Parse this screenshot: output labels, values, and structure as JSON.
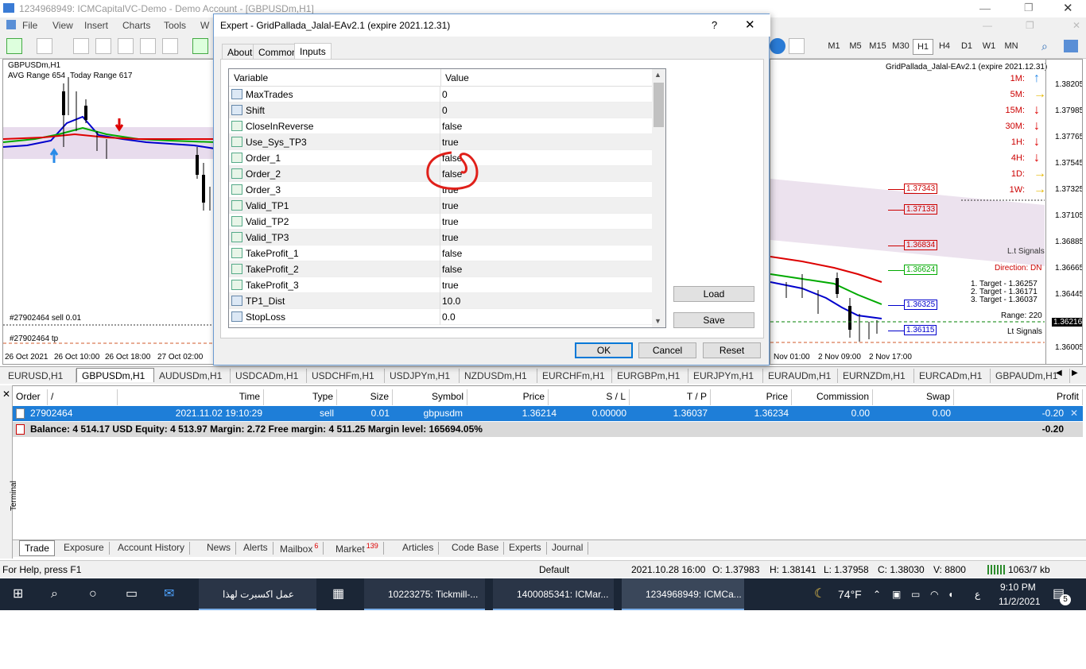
{
  "window": {
    "title": "1234968949: ICMCapitalVC-Demo - Demo Account - [GBPUSDm,H1]"
  },
  "menu": [
    "File",
    "View",
    "Insert",
    "Charts",
    "Tools",
    "W"
  ],
  "timeframes": [
    "M1",
    "M5",
    "M15",
    "M30",
    "H1",
    "H4",
    "D1",
    "W1",
    "MN"
  ],
  "active_timeframe": "H1",
  "chart_left": {
    "symbol": "GBPUSDm,H1",
    "avg_range": "AVG Range 654",
    "today_range": "Today Range 617",
    "order_label": "#27902464 sell 0.01",
    "tp_label": "#27902464 tp",
    "time_labels": [
      "26 Oct 2021",
      "26 Oct 10:00",
      "26 Oct 18:00",
      "27 Oct 02:00"
    ]
  },
  "chart_right": {
    "ea_label": "GridPallada_Jalal-EAv2.1 (expire 2021.12.31)",
    "tf_signals": [
      {
        "tf": "1M:",
        "dir": "up"
      },
      {
        "tf": "5M:",
        "dir": "right"
      },
      {
        "tf": "15M:",
        "dir": "down"
      },
      {
        "tf": "30M:",
        "dir": "down"
      },
      {
        "tf": "1H:",
        "dir": "down"
      },
      {
        "tf": "4H:",
        "dir": "down"
      },
      {
        "tf": "1D:",
        "dir": "right"
      },
      {
        "tf": "1W:",
        "dir": "right"
      }
    ],
    "price_axis": [
      "1.38205",
      "1.37985",
      "1.37765",
      "1.37545",
      "1.37325",
      "1.37105",
      "1.36885",
      "1.36665",
      "1.36445",
      "1.36216",
      "1.36005"
    ],
    "current_price": "1.36216",
    "levels": [
      {
        "value": "1.37343",
        "color": "#cc0000"
      },
      {
        "value": "1.37133",
        "color": "#cc0000"
      },
      {
        "value": "1.36834",
        "color": "#cc0000"
      },
      {
        "value": "1.36624",
        "color": "#00aa00"
      },
      {
        "value": "1.36325",
        "color": "#0000cc"
      },
      {
        "value": "1.36115",
        "color": "#0000cc"
      }
    ],
    "lt_signals": "L.t Signals",
    "direction": "Direction: DN",
    "targets": [
      "1. Target - 1.36257",
      "2. Target - 1.36171",
      "3. Target - 1.36037"
    ],
    "range": "Range: 220",
    "lt_signals2": "Lt Signals",
    "time_labels": [
      "Nov 01:00",
      "2 Nov 09:00",
      "2 Nov 17:00"
    ]
  },
  "dialog": {
    "title": "Expert - GridPallada_Jalal-EAv2.1 (expire 2021.12.31)",
    "help": "?",
    "close": "✕",
    "tabs": [
      "About",
      "Common",
      "Inputs"
    ],
    "active_tab": "Inputs",
    "col_variable": "Variable",
    "col_value": "Value",
    "params": [
      {
        "name": "MaxTrades",
        "value": "0",
        "type": "n"
      },
      {
        "name": "Shift",
        "value": "0",
        "type": "n"
      },
      {
        "name": "CloseInReverse",
        "value": "false",
        "type": "b"
      },
      {
        "name": "Use_Sys_TP3",
        "value": "true",
        "type": "b"
      },
      {
        "name": "Order_1",
        "value": "false",
        "type": "b"
      },
      {
        "name": "Order_2",
        "value": "false",
        "type": "b"
      },
      {
        "name": "Order_3",
        "value": "true",
        "type": "b"
      },
      {
        "name": "Valid_TP1",
        "value": "true",
        "type": "b"
      },
      {
        "name": "Valid_TP2",
        "value": "true",
        "type": "b"
      },
      {
        "name": "Valid_TP3",
        "value": "true",
        "type": "b"
      },
      {
        "name": "TakeProfit_1",
        "value": "false",
        "type": "b"
      },
      {
        "name": "TakeProfit_2",
        "value": "false",
        "type": "b"
      },
      {
        "name": "TakeProfit_3",
        "value": "true",
        "type": "b"
      },
      {
        "name": "TP1_Dist",
        "value": "10.0",
        "type": "n"
      },
      {
        "name": "StopLoss",
        "value": "0.0",
        "type": "n"
      }
    ],
    "load": "Load",
    "save": "Save",
    "ok": "OK",
    "cancel": "Cancel",
    "reset": "Reset"
  },
  "chart_tabs": [
    "EURUSD,H1",
    "GBPUSDm,H1",
    "AUDUSDm,H1",
    "USDCADm,H1",
    "USDCHFm,H1",
    "USDJPYm,H1",
    "NZDUSDm,H1",
    "EURCHFm,H1",
    "EURGBPm,H1",
    "EURJPYm,H1",
    "EURAUDm,H1",
    "EURNZDm,H1",
    "EURCADm,H1",
    "GBPAUDm,H1"
  ],
  "active_chart_tab": "GBPUSDm,H1",
  "terminal": {
    "side_label": "Terminal",
    "headers": [
      "Order",
      "/",
      "Time",
      "Type",
      "Size",
      "Symbol",
      "Price",
      "S / L",
      "T / P",
      "Price",
      "Commission",
      "Swap",
      "Profit"
    ],
    "order": {
      "order": "27902464",
      "time": "2021.11.02 19:10:29",
      "type": "sell",
      "size": "0.01",
      "symbol": "gbpusdm",
      "price": "1.36214",
      "sl": "0.00000",
      "tp": "1.36037",
      "cur_price": "1.36234",
      "commission": "0.00",
      "swap": "0.00",
      "profit": "-0.20"
    },
    "balance_line": "Balance: 4 514.17 USD  Equity: 4 513.97  Margin: 2.72  Free margin: 4 511.25  Margin level: 165694.05%",
    "balance_profit": "-0.20",
    "tabs": [
      {
        "label": "Trade",
        "badge": ""
      },
      {
        "label": "Exposure",
        "badge": ""
      },
      {
        "label": "Account History",
        "badge": ""
      },
      {
        "label": "News",
        "badge": ""
      },
      {
        "label": "Alerts",
        "badge": ""
      },
      {
        "label": "Mailbox",
        "badge": "6"
      },
      {
        "label": "Market",
        "badge": "139"
      },
      {
        "label": "Articles",
        "badge": ""
      },
      {
        "label": "Code Base",
        "badge": ""
      },
      {
        "label": "Experts",
        "badge": ""
      },
      {
        "label": "Journal",
        "badge": ""
      }
    ]
  },
  "status": {
    "help": "For Help, press F1",
    "profile": "Default",
    "datetime": "2021.10.28 16:00",
    "o": "O: 1.37983",
    "h": "H: 1.38141",
    "l": "L: 1.37958",
    "c": "C: 1.38030",
    "v": "V: 8800",
    "traffic": "1063/7 kb"
  },
  "taskbar": {
    "items": [
      "عمل اكسبرت لهذا الم...",
      "10223275: Tickmill-...",
      "1400085341: ICMar...",
      "1234968949: ICMCa..."
    ],
    "weather": "74°F",
    "lang": "ع",
    "time": "9:10 PM",
    "date": "11/2/2021",
    "notif_count": "5"
  }
}
